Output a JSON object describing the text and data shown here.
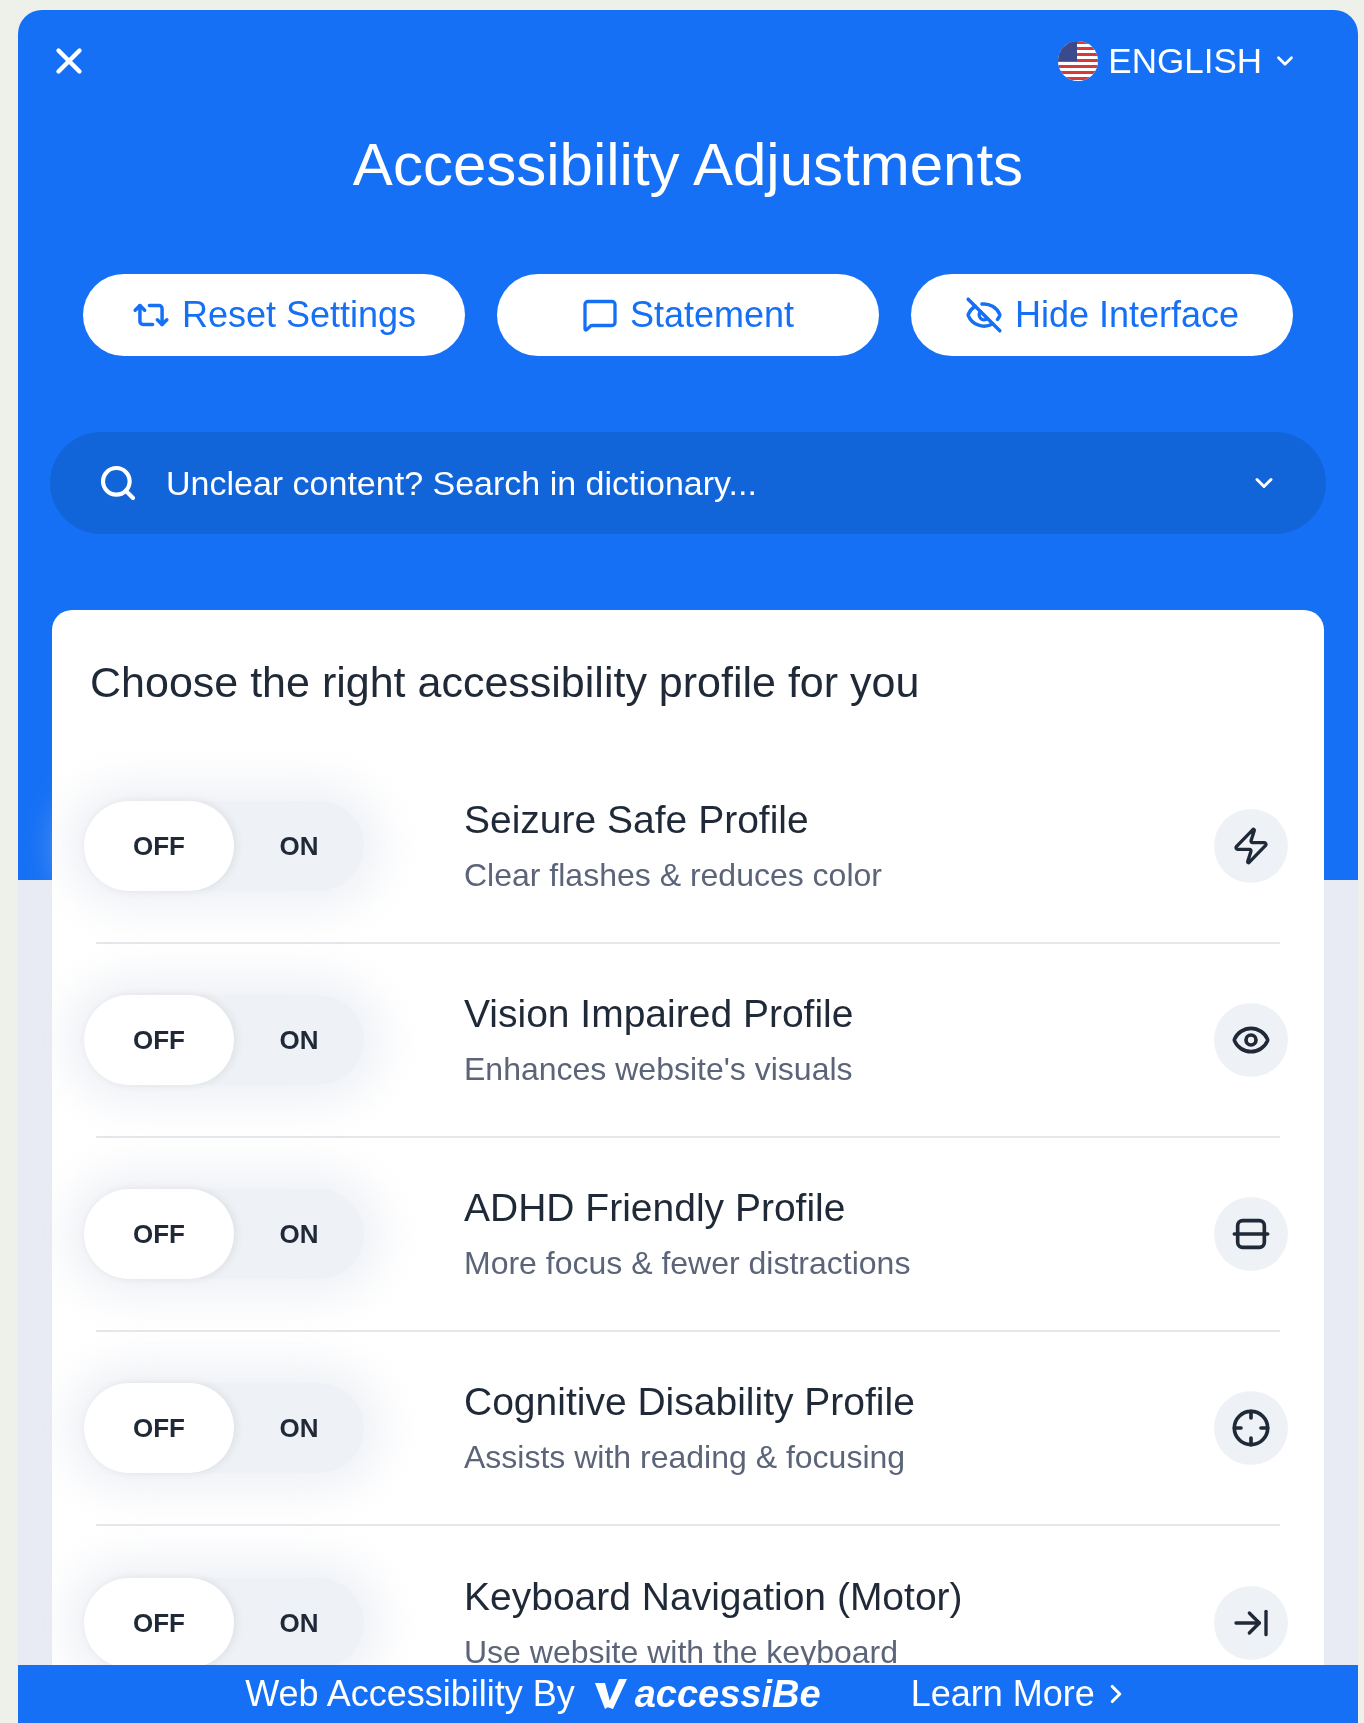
{
  "language": {
    "label": "ENGLISH"
  },
  "title": "Accessibility Adjustments",
  "buttons": [
    {
      "label": "Reset Settings"
    },
    {
      "label": "Statement"
    },
    {
      "label": "Hide Interface"
    }
  ],
  "search": {
    "placeholder": "Unclear content? Search in dictionary..."
  },
  "profiles_card": {
    "heading": "Choose the right accessibility profile for you",
    "profiles": [
      {
        "title": "Seizure Safe Profile",
        "subtitle": "Clear flashes & reduces color",
        "off_label": "OFF",
        "on_label": "ON",
        "on": false
      },
      {
        "title": "Vision Impaired Profile",
        "subtitle": "Enhances website's visuals",
        "off_label": "OFF",
        "on_label": "ON",
        "on": false
      },
      {
        "title": "ADHD Friendly Profile",
        "subtitle": "More focus & fewer distractions",
        "off_label": "OFF",
        "on_label": "ON",
        "on": false
      },
      {
        "title": "Cognitive Disability Profile",
        "subtitle": "Assists with reading & focusing",
        "off_label": "OFF",
        "on_label": "ON",
        "on": false
      },
      {
        "title": "Keyboard Navigation (Motor)",
        "subtitle": "Use website with the keyboard",
        "off_label": "OFF",
        "on_label": "ON",
        "on": false
      }
    ]
  },
  "footer": {
    "credit": "Web Accessibility By",
    "brand": "accessiBe",
    "link": "Learn More"
  }
}
